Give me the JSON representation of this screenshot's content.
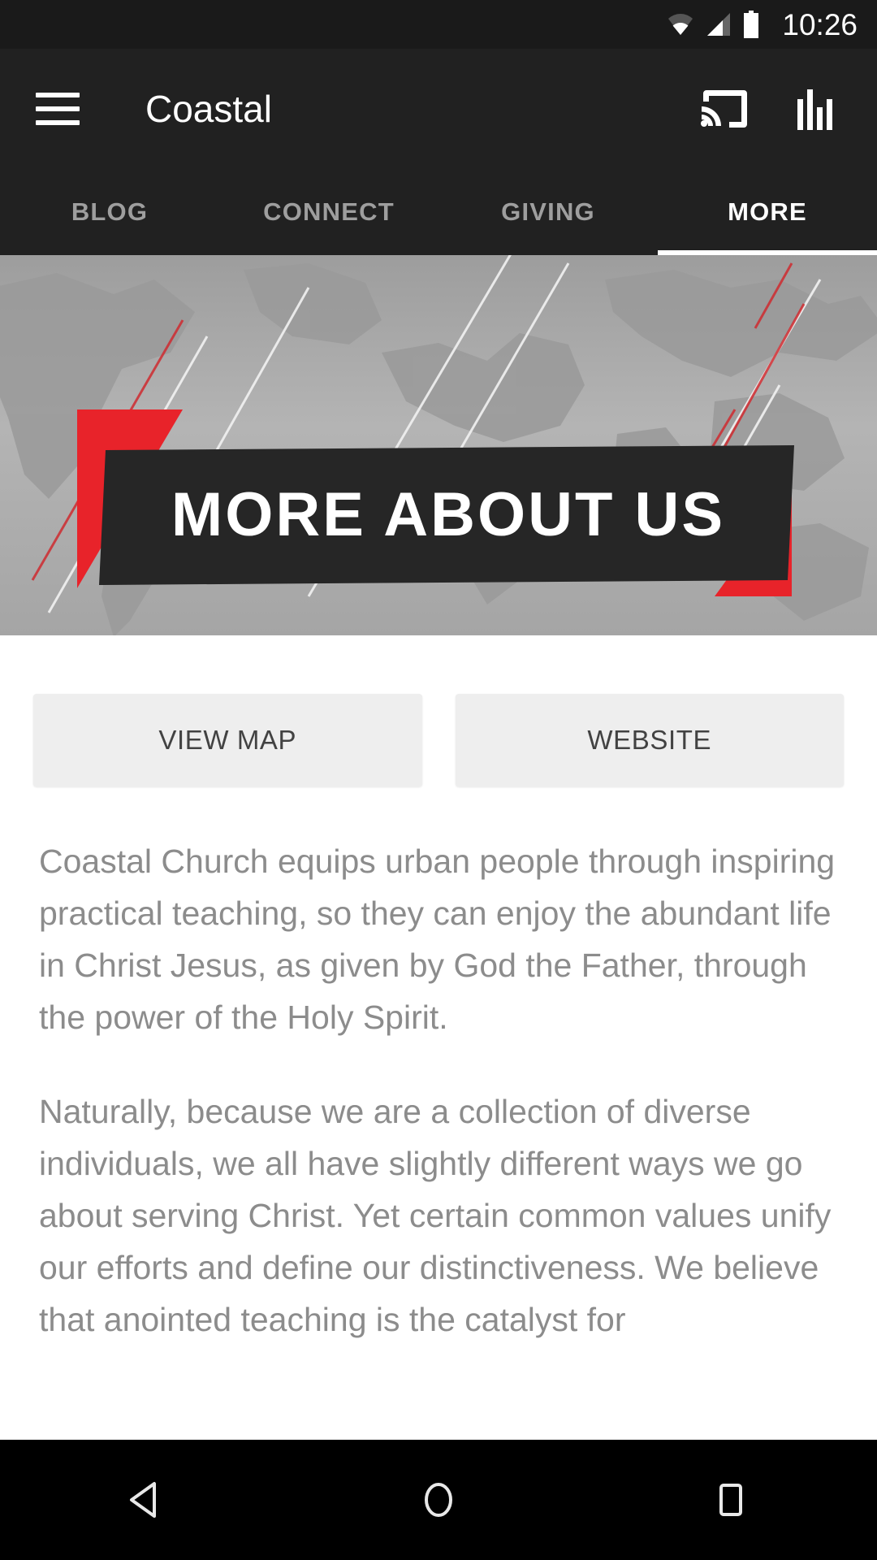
{
  "status_bar": {
    "time": "10:26",
    "icons": [
      "wifi-icon",
      "cellular-signal-icon",
      "battery-icon"
    ]
  },
  "app_bar": {
    "title": "Coastal",
    "menu_icon": "hamburger-menu-icon",
    "cast_icon": "cast-icon",
    "equalizer_icon": "equalizer-bar-chart-icon",
    "background_color": "#212121"
  },
  "tabs": {
    "items": [
      {
        "label": "BLOG",
        "active": false
      },
      {
        "label": "CONNECT",
        "active": false
      },
      {
        "label": "GIVING",
        "active": false
      },
      {
        "label": "MORE",
        "active": true
      }
    ],
    "active_index": 3,
    "indicator_color": "#ffffff",
    "inactive_color": "#9e9e9e"
  },
  "hero": {
    "headline": "MORE ABOUT US",
    "background_description": "world-map-graphic",
    "accent_color": "#e8232a",
    "plate_color": "#262626",
    "map_color": "#adadad"
  },
  "actions": {
    "view_map_label": "VIEW MAP",
    "website_label": "WEBSITE",
    "button_background": "#eeeeee",
    "button_text_color": "#424242"
  },
  "about": {
    "paragraphs": [
      "Coastal Church equips urban people through inspiring practical teaching, so they can enjoy the abundant life in Christ Jesus, as given by God the Father, through the power of the Holy Spirit.",
      "Naturally, because we are a collection of diverse individuals, we all have slightly different ways we go about serving Christ. Yet certain common values unify our efforts and define our distinctiveness. We believe that anointed teaching is the catalyst for"
    ],
    "text_color": "#8c8c8c"
  },
  "nav_bar": {
    "back_icon": "back-triangle-icon",
    "home_icon": "home-circle-icon",
    "recents_icon": "recents-square-icon",
    "background_color": "#000000"
  }
}
